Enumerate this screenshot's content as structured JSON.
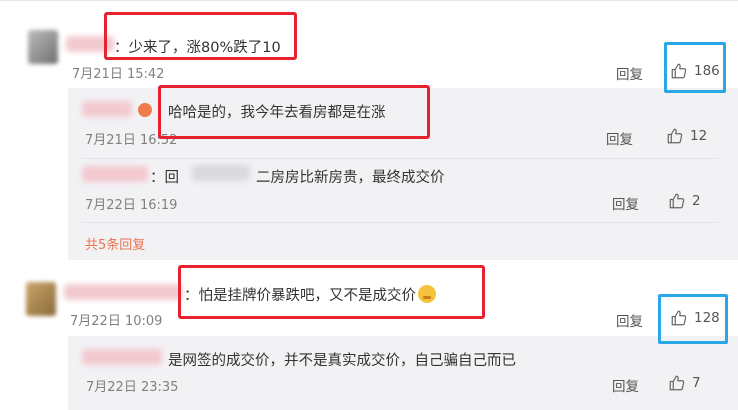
{
  "comments": [
    {
      "text": "：少来了，涨80%跌了10",
      "time": "7月21日 15:42",
      "reply_label": "回复",
      "likes": "186",
      "replies": [
        {
          "text": "哈哈是的，我今年去看房都是在涨",
          "time": "7月21日 16:52",
          "reply_label": "回复",
          "likes": "12"
        },
        {
          "text": "：回复 ：二房房比新房贵，最终成交价",
          "prefix": "：回",
          "suffix": "二房房比新房贵，最终成交价",
          "time": "7月22日 16:19",
          "reply_label": "回复",
          "likes": "2"
        }
      ],
      "more_replies": "共5条回复"
    },
    {
      "text": "：怕是挂牌价暴跌吧，又不是成交价",
      "time": "7月22日 10:09",
      "reply_label": "回复",
      "likes": "128",
      "replies": [
        {
          "text": "是网签的成交价，并不是真实成交价，自己骗自己而已",
          "time": "7月22日 23:35",
          "reply_label": "回复",
          "likes": "7"
        }
      ]
    }
  ],
  "colors": {
    "highlight_red": "#e8212f",
    "highlight_blue": "#2aa7e6",
    "link_orange": "#eb7350"
  },
  "icons": {
    "like": "thumbs-up-icon"
  }
}
